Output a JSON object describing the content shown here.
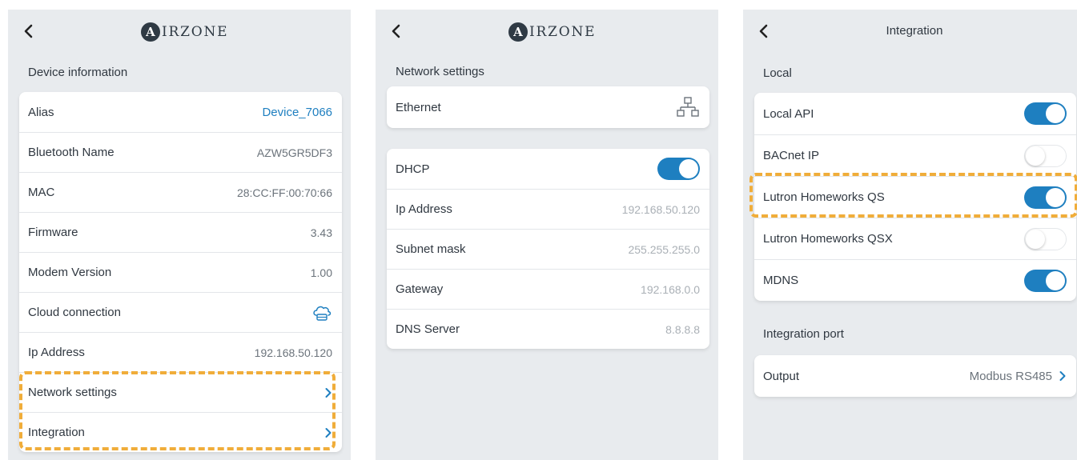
{
  "panel1": {
    "logo_letter": "A",
    "logo_text": "IRZONE",
    "section": "Device information",
    "rows": [
      {
        "label": "Alias",
        "value": "Device_7066"
      },
      {
        "label": "Bluetooth Name",
        "value": "AZW5GR5DF3"
      },
      {
        "label": "MAC",
        "value": "28:CC:FF:00:70:66"
      },
      {
        "label": "Firmware",
        "value": "3.43"
      },
      {
        "label": "Modem Version",
        "value": "1.00"
      },
      {
        "label": "Cloud connection",
        "icon": "cloud-storage-icon"
      },
      {
        "label": "Ip Address",
        "value": "192.168.50.120"
      },
      {
        "label": "Network settings",
        "icon": "chevron-right-icon"
      },
      {
        "label": "Integration",
        "icon": "chevron-right-icon"
      }
    ]
  },
  "panel2": {
    "logo_letter": "A",
    "logo_text": "IRZONE",
    "section": "Network settings",
    "ethernet": {
      "label": "Ethernet",
      "icon": "network-icon"
    },
    "rows": [
      {
        "label": "DHCP",
        "toggle": true
      },
      {
        "label": "Ip Address",
        "value": "192.168.50.120"
      },
      {
        "label": "Subnet mask",
        "value": "255.255.255.0"
      },
      {
        "label": "Gateway",
        "value": "192.168.0.0"
      },
      {
        "label": "DNS Server",
        "value": "8.8.8.8"
      }
    ]
  },
  "panel3": {
    "title": "Integration",
    "section_local": "Local",
    "rows": [
      {
        "label": "Local API",
        "toggle": true
      },
      {
        "label": "BACnet IP",
        "toggle": false
      },
      {
        "label": "Lutron Homeworks QS",
        "toggle": true
      },
      {
        "label": "Lutron Homeworks QSX",
        "toggle": false
      },
      {
        "label": "MDNS",
        "toggle": true
      }
    ],
    "section_port": "Integration port",
    "output": {
      "label": "Output",
      "value": "Modbus RS485"
    }
  },
  "colors": {
    "accent": "#1e7fc0",
    "highlight": "#f0ad3a",
    "background": "#e8ebee"
  }
}
